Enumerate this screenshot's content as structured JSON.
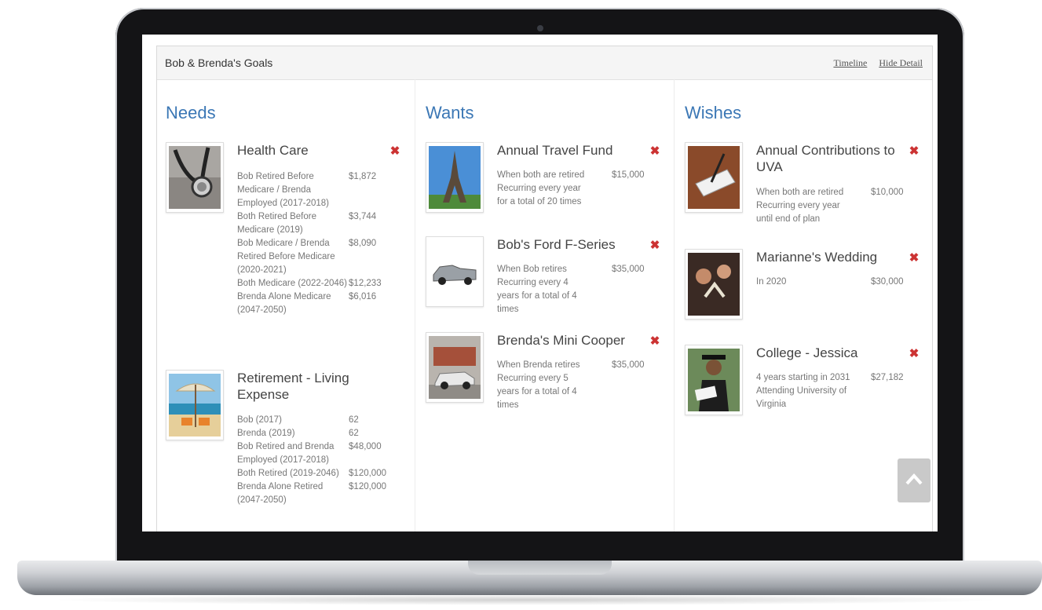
{
  "header": {
    "title": "Bob & Brenda's Goals",
    "timeline_link": "Timeline",
    "hide_detail_link": "Hide Detail"
  },
  "columns": {
    "needs": {
      "title": "Needs",
      "goals": [
        {
          "name": "Health Care",
          "image": "stethoscope-image",
          "rows": [
            {
              "label": "Bob Retired Before Medicare / Brenda Employed (2017-2018)",
              "amount": "$1,872"
            },
            {
              "label": "Both Retired Before Medicare (2019)",
              "amount": "$3,744"
            },
            {
              "label": "Bob Medicare / Brenda Retired Before Medicare (2020-2021)",
              "amount": "$8,090"
            },
            {
              "label": "Both Medicare (2022-2046)",
              "amount": "$12,233"
            },
            {
              "label": "Brenda Alone Medicare (2047-2050)",
              "amount": "$6,016"
            }
          ]
        },
        {
          "name": "Retirement - Living Expense",
          "image": "beach-umbrella-image",
          "rows": [
            {
              "label": "Bob (2017)",
              "amount": "62"
            },
            {
              "label": "Brenda (2019)",
              "amount": "62"
            },
            {
              "label": "Bob Retired and Brenda Employed (2017-2018)",
              "amount": "$48,000"
            },
            {
              "label": "Both Retired (2019-2046)",
              "amount": "$120,000"
            },
            {
              "label": "Brenda Alone Retired (2047-2050)",
              "amount": "$120,000"
            }
          ]
        }
      ]
    },
    "wants": {
      "title": "Wants",
      "goals": [
        {
          "name": "Annual Travel Fund",
          "image": "eiffel-tower-image",
          "desc": "When both are retired Recurring every year for a total of 20 times",
          "amount": "$15,000"
        },
        {
          "name": "Bob's Ford F-Series",
          "image": "pickup-truck-image",
          "desc": "When Bob retires Recurring every 4 years for a total of 4 times",
          "amount": "$35,000"
        },
        {
          "name": "Brenda's Mini Cooper",
          "image": "mini-cooper-image",
          "desc": "When Brenda retires Recurring every 5 years for a total of 4 times",
          "amount": "$35,000"
        }
      ]
    },
    "wishes": {
      "title": "Wishes",
      "goals": [
        {
          "name": "Annual Contributions to UVA",
          "image": "check-writing-image",
          "desc": "When both are retired Recurring every year until end of plan",
          "amount": "$10,000"
        },
        {
          "name": "Marianne's Wedding",
          "image": "wedding-toast-image",
          "desc": "In 2020",
          "amount": "$30,000"
        },
        {
          "name": "College - Jessica",
          "image": "graduate-image",
          "desc": "4 years starting in 2031 Attending University of Virginia",
          "amount": "$27,182"
        }
      ]
    }
  },
  "icons": {
    "remove": "close-x-icon",
    "scroll_top": "chevron-up-icon"
  },
  "colors": {
    "accent": "#3b77b5",
    "remove": "#cc3333",
    "text_muted": "#777777"
  }
}
